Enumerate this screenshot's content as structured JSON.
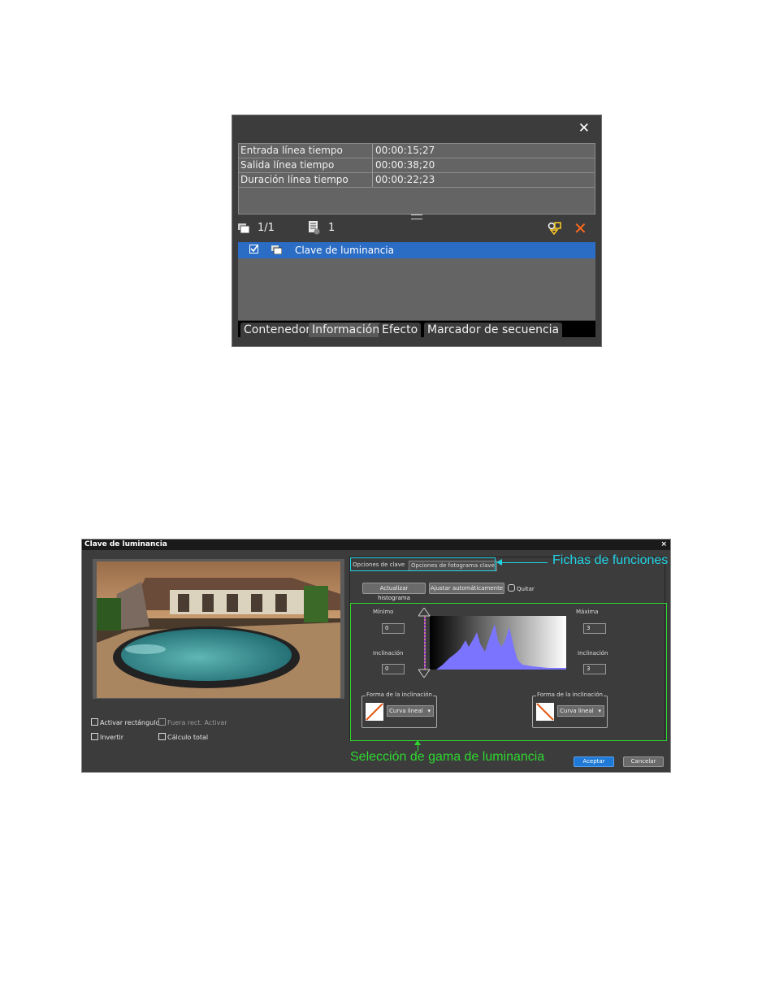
{
  "info_panel": {
    "close_label": "✕",
    "rows": [
      {
        "key": "Entrada línea tiempo",
        "value": "00:00:15;27"
      },
      {
        "key": "Salida línea tiempo",
        "value": "00:00:38;20"
      },
      {
        "key": "Duración línea tiempo",
        "value": "00:00:22;23"
      }
    ],
    "toolbar": {
      "count_a": "1/1",
      "count_b": "1",
      "delete_label": "✕"
    },
    "effect_item": {
      "label": "Clave de luminancia",
      "checked": true
    },
    "tabs": [
      "Contenedor",
      "Información",
      "Efecto",
      "Marcador de secuencia"
    ],
    "active_tab": "Información"
  },
  "dialog": {
    "title": "Clave de luminancia",
    "close_label": "×",
    "options": {
      "activar_rect": "Activar rectángulo",
      "fuera_rect": "Fuera rect. Activar",
      "invertir": "Invertir",
      "calculo_total": "Cálculo total"
    },
    "tabs": [
      "Opciones de clave",
      "Opciones de fotograma clave"
    ],
    "buttons": {
      "update_histogram": "Actualizar histograma",
      "auto_adjust": "Ajustar automáticamente",
      "quitar": "Quitar"
    },
    "left": {
      "min_label": "Mínimo",
      "min_value": "0",
      "slope_label": "Inclinación",
      "slope_value": "0"
    },
    "right": {
      "max_label": "Máxima",
      "max_value": "3",
      "slope_label": "Inclinación",
      "slope_value": "3"
    },
    "shape_group": {
      "caption": "Forma de la inclinación",
      "curve": "Curva lineal",
      "arrow": "▾"
    },
    "ok_label": "Aceptar",
    "cancel_label": "Cancelar"
  },
  "annotations": {
    "tabs_note": "Fichas de funciones",
    "range_note": "Selección de gama de luminancia"
  },
  "colors": {
    "accent_cyan": "#22d3e6",
    "accent_green": "#2ed82e",
    "selection_blue": "#2b6cc4",
    "histogram": "#7b74ff"
  }
}
